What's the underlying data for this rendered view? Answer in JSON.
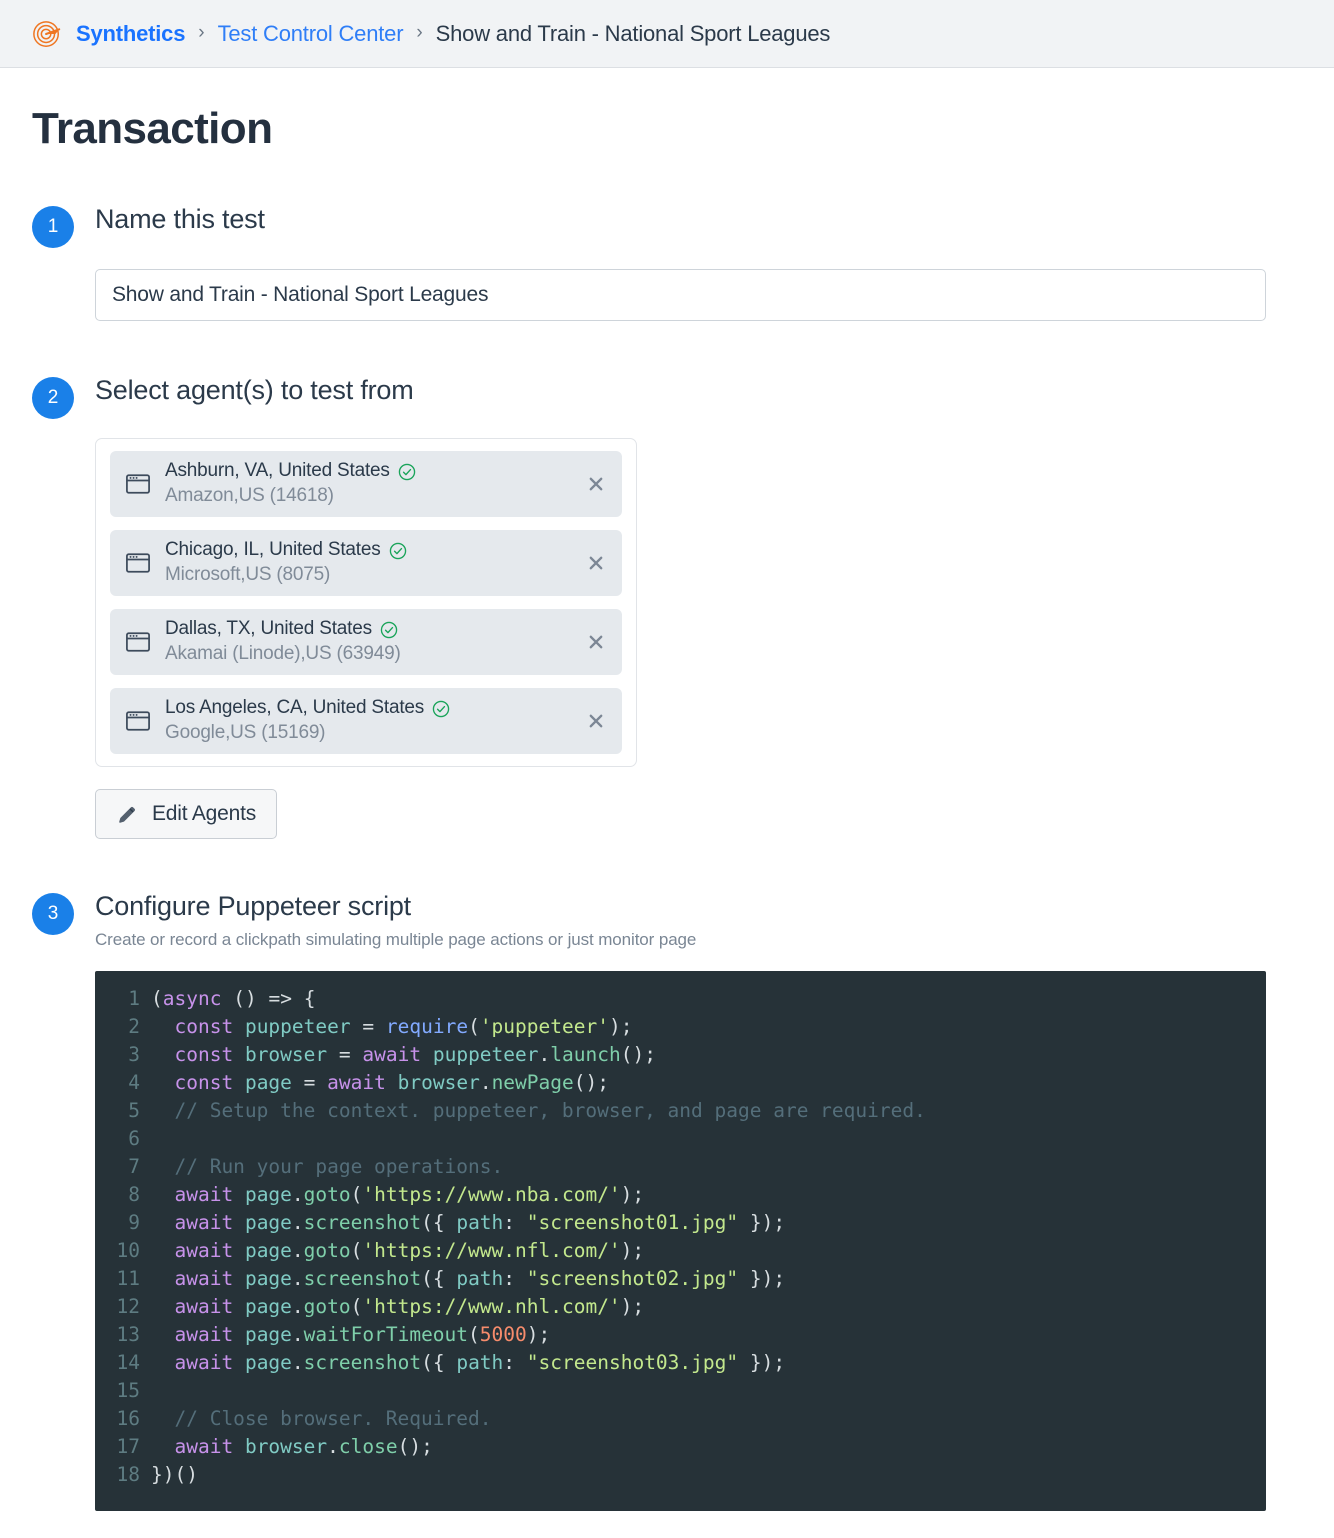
{
  "breadcrumb": {
    "logo_icon": "synthetics-target-logo",
    "separator": "›",
    "items": [
      {
        "label": "Synthetics",
        "type": "brand"
      },
      {
        "label": "Test Control Center",
        "type": "link"
      },
      {
        "label": "Show and Train - National Sport Leagues",
        "type": "current"
      }
    ]
  },
  "page": {
    "title": "Transaction"
  },
  "steps": [
    {
      "number": "1",
      "title": "Name this test",
      "subtitle": ""
    },
    {
      "number": "2",
      "title": "Select agent(s) to test from",
      "subtitle": ""
    },
    {
      "number": "3",
      "title": "Configure Puppeteer script",
      "subtitle": "Create or record a clickpath simulating multiple page actions or just monitor page"
    }
  ],
  "name_field": {
    "value": "Show and Train - National Sport Leagues",
    "placeholder": "Name this test"
  },
  "agents": [
    {
      "location": "Ashburn, VA, United States",
      "provider": "Amazon,US (14618)",
      "status_icon": "check-circle-icon",
      "status_color": "#1aa45a",
      "browser_icon": "browser-window-icon",
      "remove_label": "✕"
    },
    {
      "location": "Chicago, IL, United States",
      "provider": "Microsoft,US (8075)",
      "status_icon": "check-circle-icon",
      "status_color": "#1aa45a",
      "browser_icon": "browser-window-icon",
      "remove_label": "✕"
    },
    {
      "location": "Dallas, TX, United States",
      "provider": "Akamai (Linode),US (63949)",
      "status_icon": "check-circle-icon",
      "status_color": "#1aa45a",
      "browser_icon": "browser-window-icon",
      "remove_label": "✕"
    },
    {
      "location": "Los Angeles, CA, United States",
      "provider": "Google,US (15169)",
      "status_icon": "check-circle-icon",
      "status_color": "#1aa45a",
      "browser_icon": "browser-window-icon",
      "remove_label": "✕"
    }
  ],
  "edit_agents_button": {
    "label": "Edit Agents",
    "icon": "pencil-icon"
  },
  "code_editor": {
    "language": "javascript",
    "theme_background": "#263238",
    "line_count": 18,
    "lines": [
      {
        "n": "1",
        "text": "(async () => {"
      },
      {
        "n": "2",
        "text": "  const puppeteer = require('puppeteer');"
      },
      {
        "n": "3",
        "text": "  const browser = await puppeteer.launch();"
      },
      {
        "n": "4",
        "text": "  const page = await browser.newPage();"
      },
      {
        "n": "5",
        "text": "  // Setup the context. puppeteer, browser, and page are required."
      },
      {
        "n": "6",
        "text": ""
      },
      {
        "n": "7",
        "text": "  // Run your page operations."
      },
      {
        "n": "8",
        "text": "  await page.goto('https://www.nba.com/');"
      },
      {
        "n": "9",
        "text": "  await page.screenshot({ path: \"screenshot01.jpg\" });"
      },
      {
        "n": "10",
        "text": "  await page.goto('https://www.nfl.com/');"
      },
      {
        "n": "11",
        "text": "  await page.screenshot({ path: \"screenshot02.jpg\" });"
      },
      {
        "n": "12",
        "text": "  await page.goto('https://www.nhl.com/');"
      },
      {
        "n": "13",
        "text": "  await page.waitForTimeout(5000);"
      },
      {
        "n": "14",
        "text": "  await page.screenshot({ path: \"screenshot03.jpg\" });"
      },
      {
        "n": "15",
        "text": ""
      },
      {
        "n": "16",
        "text": "  // Close browser. Required."
      },
      {
        "n": "17",
        "text": "  await browser.close();"
      },
      {
        "n": "18",
        "text": "})()"
      }
    ]
  },
  "colors": {
    "accent_blue": "#1a80e8",
    "link_blue": "#2f7ef7",
    "brand_orange": "#ef7622",
    "status_green": "#1aa45a",
    "heading": "#24303f",
    "muted": "#7a8694",
    "editor_bg": "#263238"
  }
}
